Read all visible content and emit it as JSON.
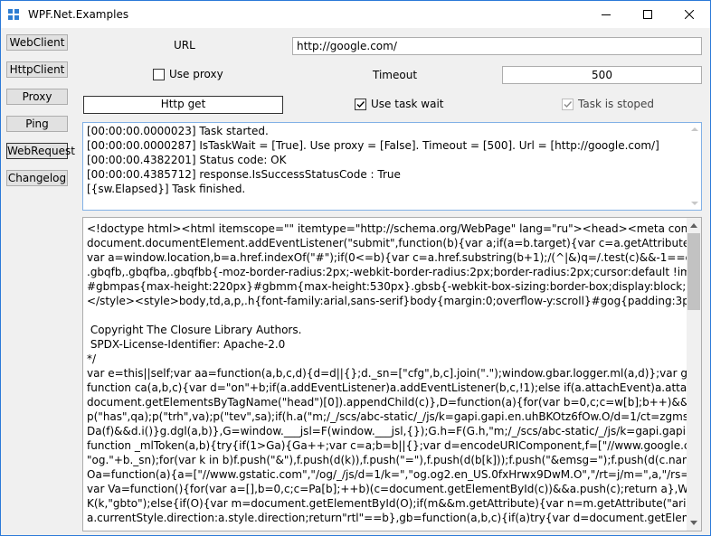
{
  "window": {
    "title": "WPF.Net.Examples",
    "icon": "app-grid-icon",
    "controls": [
      "minimize-icon",
      "maximize-icon",
      "close-icon"
    ]
  },
  "sidebar": {
    "items": [
      {
        "label": "WebClient"
      },
      {
        "label": "HttpClient"
      },
      {
        "label": "Proxy"
      },
      {
        "label": "Ping"
      },
      {
        "label": "WebRequest"
      },
      {
        "label": "Changelog"
      }
    ]
  },
  "form": {
    "url_label": "URL",
    "url_value": "http://google.com/",
    "use_proxy_label": "Use proxy",
    "use_proxy_checked": false,
    "timeout_label": "Timeout",
    "timeout_value": "500",
    "http_get_label": "Http get",
    "use_task_wait_label": "Use task wait",
    "use_task_wait_checked": true,
    "task_stoped_label": "Task is stoped",
    "task_stoped_checked": true
  },
  "log": {
    "lines": [
      "[00:00:00.0000023] Task started.",
      "[00:00:00.0000287] IsTaskWait = [True]. Use proxy = [False]. Timeout = [500]. Url = [http://google.com/]",
      "[00:00:00.4382201] Status code: OK",
      "[00:00:00.4385712] response.IsSuccessStatusCode : True",
      "[{sw.Elapsed}] Task finished."
    ]
  },
  "response": {
    "lines": [
      "<!doctype html><html itemscope=\"\" itemtype=\"http://schema.org/WebPage\" lang=\"ru\"><head><meta content=\"&#1055;&",
      "document.documentElement.addEventListener(\"submit\",function(b){var a;if(a=b.target){var c=a.getAttribute(\"data-submitfalse",
      "var a=window.location,b=a.href.indexOf(\"#\");if(0<=b){var c=a.href.substring(b+1);/(^|&)q=/.test(c)&&-1==c.indexOf(\"#\")&&a",
      ".gbqfb,.gbqfba,.gbqfbb{-moz-border-radius:2px;-webkit-border-radius:2px;border-radius:2px;cursor:default !important;display",
      "#gbmpas{max-height:220px}#gbmm{max-height:530px}.gbsb{-webkit-box-sizing:border-box;display:block;position:relative;*zo",
      "</style><style>body,td,a,p,.h{font-family:arial,sans-serif}body{margin:0;overflow-y:scroll}#gog{padding:3px 8px 0}td{line-heig",
      "",
      " Copyright The Closure Library Authors.",
      " SPDX-License-Identifier: Apache-2.0",
      "*/",
      "var e=this||self;var aa=function(a,b,c,d){d=d||{};d._sn=[\"cfg\",b,c].join(\".\");window.gbar.logger.ml(a,d)};var g=window.gbar=windo",
      "function ca(a,b,c){var d=\"on\"+b;if(a.addEventListener)a.addEventListener(b,c,!1);else if(a.attachEvent)a.attachEvent(d,c);else{var",
      "document.getElementsByTagName(\"head\")[0]).appendChild(c)},D=function(a){for(var b=0,c;c=w[b];b++)&&c[0]!=a;++b);!c||c[1].l||c",
      "p(\"has\",qa);p(\"trh\",va);p(\"tev\",sa);if(h.a(\"m;/_/scs/abc-static/_/js/k=gapi.gapi.en.uhBKOtz6fOw.O/d=1/ct=zgms/rs=AHpOoo8GZ",
      "Da(f)&&d.i()}g.dgl(a,b)},G=window.___jsl=F(window.___jsl,{});G.h=F(G.h,\"m;/_/scs/abc-static/_/js/k=gapi.gapi.en.uhBKOtz6fOw.O",
      "function _mlToken(a,b){try{if(1>Ga){Ga++;var c=a;b=b||{};var d=encodeURIComponent,f=[\"//www.google.com/gen_204?atyp=",
      "\"og.\"+b._sn);for(var k in b)f.push(\"&\"),f.push(d(k)),f.push(\"=\"),f.push(d(b[k]));f.push(\"&emsg=\");f.push(d(c.name+\":\"+c.message",
      "Oa=function(a){a=[\"//www.gstatic.com\",\"/og/_/js/d=1/k=\",\"og.og2.en_US.0fxHrwx9DwM.O\",\"/rt=j/m=\",a,\"/rs=\",\"AA2YrTuwNY",
      "var Va=function(){for(var a=[],b=0,c;c=Pa[b];++b)(c=document.getElementById(c))&&a.push(c);return a},Wa=function(){var a",
      "K(k,\"gbto\");else{if(O){var m=document.getElementById(O);if(m&&m.getAttribute){var n=m.getAttribute(\"aria-owner\");if(n.leng",
      "a.currentStyle.direction:a.style.direction;return\"rtl\"==b},gb=function(a,b,c){if(a)try{var d=document.getElementById(\"gbd5\");if("
    ]
  }
}
